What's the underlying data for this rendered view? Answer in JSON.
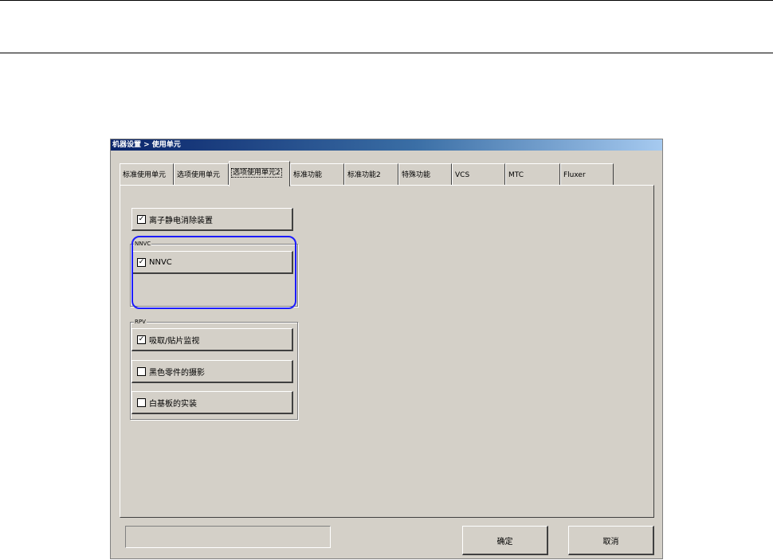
{
  "window": {
    "title": "机器设置 > 使用单元"
  },
  "tabs": [
    {
      "label": "标准使用单元"
    },
    {
      "label": "选项使用单元"
    },
    {
      "label": "选项使用单元2"
    },
    {
      "label": "标准功能"
    },
    {
      "label": "标准功能2"
    },
    {
      "label": "特殊功能"
    },
    {
      "label": "VCS"
    },
    {
      "label": "MTC"
    },
    {
      "label": "Fluxer"
    }
  ],
  "active_tab": "选项使用单元2",
  "options": {
    "ionizer": {
      "label": "离子静电消除装置",
      "checked": true,
      "mark": "✓"
    },
    "nnvc_group": {
      "label": "NNVC"
    },
    "nnvc": {
      "label": "NNVC",
      "checked": true,
      "mark": "✓"
    },
    "rpv_group": {
      "label": "RPV"
    },
    "pickup_monitor": {
      "label": "吸取/贴片监视",
      "checked": true,
      "mark": "✓"
    },
    "black_part": {
      "label": "黑色零件的摄影",
      "checked": false,
      "mark": ""
    },
    "white_board": {
      "label": "白基板的实装",
      "checked": false,
      "mark": ""
    }
  },
  "footer": {
    "ok_label": "确定",
    "cancel_label": "取消"
  },
  "colors": {
    "highlight": "#1c1cff",
    "title_bar": "#0a246a",
    "face": "#d4d0c8"
  }
}
